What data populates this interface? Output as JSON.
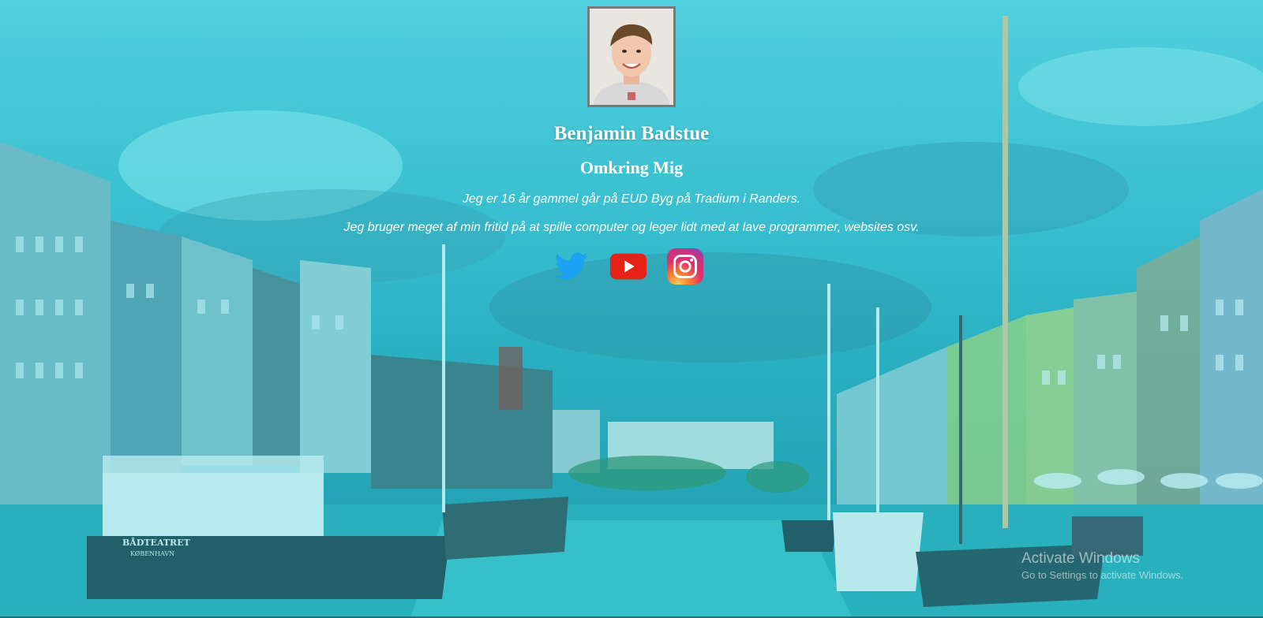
{
  "profile": {
    "name": "Benjamin Badstue",
    "section_title": "Omkring Mig",
    "paragraphs": [
      "Jeg er 16 år gammel går på EUD Byg på Tradium i Randers.",
      "Jeg bruger meget af min fritid på at spille computer og leger lidt med at lave programmer, websites osv."
    ]
  },
  "social": [
    {
      "icon": "twitter-icon",
      "color": "#1da1f2"
    },
    {
      "icon": "youtube-icon",
      "color": "#e62117"
    },
    {
      "icon": "instagram-icon",
      "color": "#c13584"
    }
  ],
  "background": {
    "scene": "canal-harbor-photo",
    "boat_label_1": "BÅDTEATRET",
    "boat_label_2": "KØBENHAVN",
    "tint_color": "#3fbccd"
  },
  "watermark": {
    "title": "Activate Windows",
    "subtitle": "Go to Settings to activate Windows."
  }
}
